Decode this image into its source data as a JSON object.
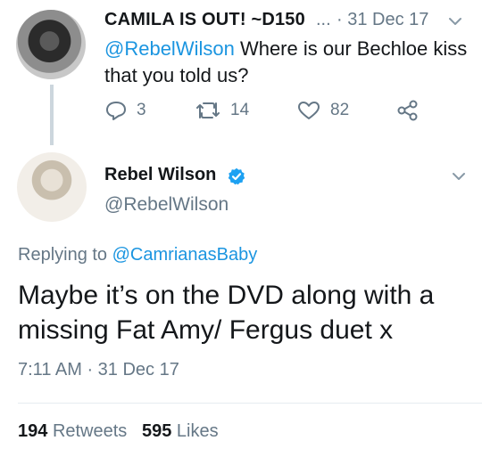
{
  "original_tweet": {
    "display_name": "CAMILA IS OUT! ~D150",
    "ellipsis": "...",
    "timestamp": "· 31 Dec 17",
    "mention": "@RebelWilson",
    "body": " Where is our Bechloe kiss that you told us?",
    "reply_count": "3",
    "retweet_count": "14",
    "like_count": "82"
  },
  "reply_tweet": {
    "display_name": "Rebel Wilson",
    "handle": "@RebelWilson",
    "replying_prefix": "Replying to ",
    "replying_to": "@CamrianasBaby",
    "body": "Maybe it’s on the DVD along with a missing Fat Amy/ Fergus duet x",
    "timestamp": "7:11 AM · 31 Dec 17",
    "retweets": "194",
    "retweets_label": "Retweets",
    "likes": "595",
    "likes_label": "Likes"
  },
  "colors": {
    "link": "#1b95e0",
    "muted": "#657786",
    "text": "#14171a",
    "verified": "#1da1f2"
  },
  "icons": [
    "reply-icon",
    "retweet-icon",
    "heart-icon",
    "share-icon",
    "chevron-down-icon",
    "verified-badge-icon"
  ]
}
